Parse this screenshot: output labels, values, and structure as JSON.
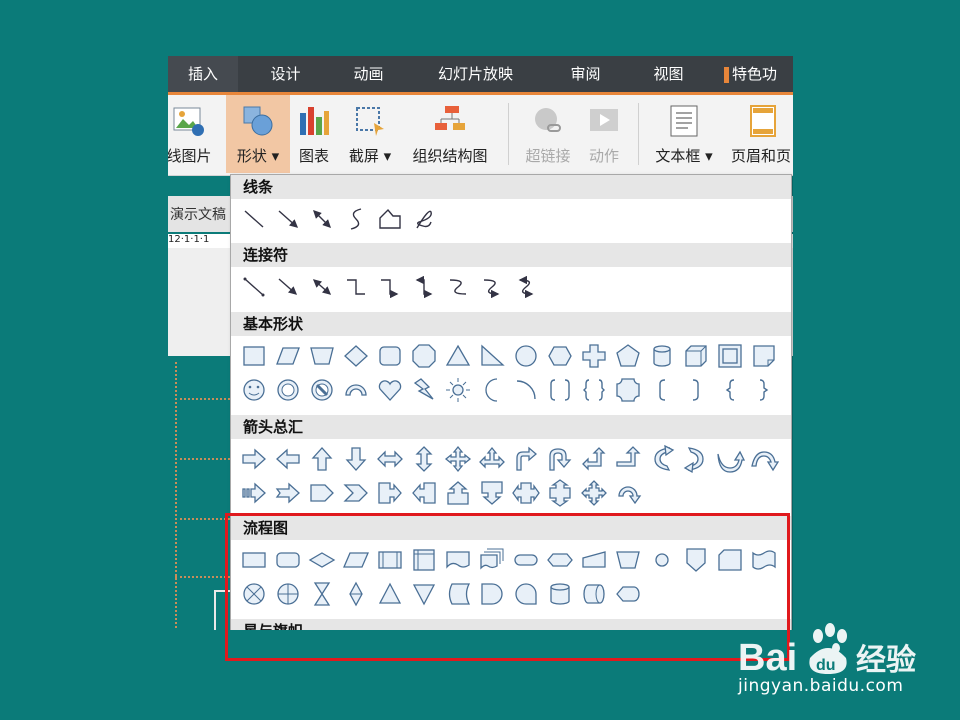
{
  "menu": {
    "tabs": [
      {
        "label": "插入",
        "active": true
      },
      {
        "label": "设计"
      },
      {
        "label": "动画"
      },
      {
        "label": "幻灯片放映"
      },
      {
        "label": "审阅"
      },
      {
        "label": "视图"
      },
      {
        "label": "特色功"
      }
    ],
    "accent_color": "#e8863a"
  },
  "ribbon": {
    "buttons": [
      {
        "label": "线图片",
        "icon": "picture-icon"
      },
      {
        "label": "形状 ▾",
        "icon": "shapes-icon",
        "active": true
      },
      {
        "label": "图表",
        "icon": "chart-icon"
      },
      {
        "label": "截屏 ▾",
        "icon": "screenshot-icon"
      },
      {
        "label": "组织结构图",
        "icon": "org-chart-icon"
      },
      {
        "label": "超链接",
        "icon": "hyperlink-icon",
        "disabled": true
      },
      {
        "label": "动作",
        "icon": "action-icon",
        "disabled": true
      },
      {
        "label": "文本框 ▾",
        "icon": "textbox-icon"
      },
      {
        "label": "页眉和页",
        "icon": "header-footer-icon"
      }
    ]
  },
  "background_doc": {
    "tab_label": "演示文稿",
    "ruler_text": "12·1·1·1"
  },
  "shape_gallery": {
    "sections": [
      {
        "title": "线条",
        "rows": [
          [
            "line",
            "arrow-line",
            "double-arrow-line",
            "curve",
            "freeform",
            "scribble"
          ]
        ]
      },
      {
        "title": "连接符",
        "rows": [
          [
            "straight-connector",
            "straight-arrow-connector",
            "double-arrow-connector",
            "elbow-connector",
            "elbow-arrow-connector",
            "elbow-double-arrow-connector",
            "curved-connector",
            "curved-arrow-connector",
            "curved-double-arrow-connector"
          ]
        ]
      },
      {
        "title": "基本形状",
        "rows": [
          [
            "rectangle",
            "parallelogram",
            "trapezoid",
            "diamond",
            "rounded-rectangle",
            "octagon",
            "triangle",
            "right-triangle",
            "ellipse",
            "hexagon",
            "cross",
            "pentagon",
            "can",
            "cube",
            "bevel",
            "folded-corner"
          ],
          [
            "smiley",
            "donut",
            "no-symbol",
            "block-arc",
            "heart",
            "lightning",
            "sun",
            "moon",
            "arc",
            "bracket-pair",
            "brace-pair",
            "plaque",
            "left-bracket",
            "right-bracket",
            "left-brace",
            "right-brace"
          ]
        ]
      },
      {
        "title": "箭头总汇",
        "rows": [
          [
            "right-arrow",
            "left-arrow",
            "up-arrow",
            "down-arrow",
            "left-right-arrow",
            "up-down-arrow",
            "quad-arrow",
            "left-right-up-arrow",
            "bent-arrow",
            "u-turn-arrow",
            "left-up-arrow",
            "bent-up-arrow",
            "curved-right-arrow",
            "curved-left-arrow",
            "curved-up-arrow",
            "curved-down-arrow"
          ],
          [
            "striped-right-arrow",
            "notched-right-arrow",
            "pentagon-arrow",
            "chevron",
            "right-arrow-callout",
            "left-arrow-callout",
            "up-arrow-callout",
            "down-arrow-callout",
            "left-right-arrow-callout",
            "up-down-arrow-callout",
            "quad-arrow-callout",
            "circular-arrow"
          ]
        ]
      },
      {
        "title": "流程图",
        "rows": [
          [
            "process",
            "alternate-process",
            "decision",
            "data",
            "predefined-process",
            "internal-storage",
            "document",
            "multidocument",
            "terminator",
            "preparation",
            "manual-input",
            "manual-operation",
            "connector",
            "off-page-connector",
            "card",
            "punched-tape"
          ],
          [
            "summing-junction",
            "or",
            "collate",
            "sort",
            "extract",
            "merge",
            "stored-data",
            "delay",
            "sequential-access-storage",
            "magnetic-disk",
            "direct-access-storage",
            "display"
          ]
        ]
      },
      {
        "title": "星与旗帜",
        "rows": []
      }
    ]
  },
  "highlight": {
    "color": "#e0191d",
    "target": "流程图"
  },
  "watermark": {
    "brand": "Bai du 经验",
    "url": "jingyan.baidu.com"
  }
}
